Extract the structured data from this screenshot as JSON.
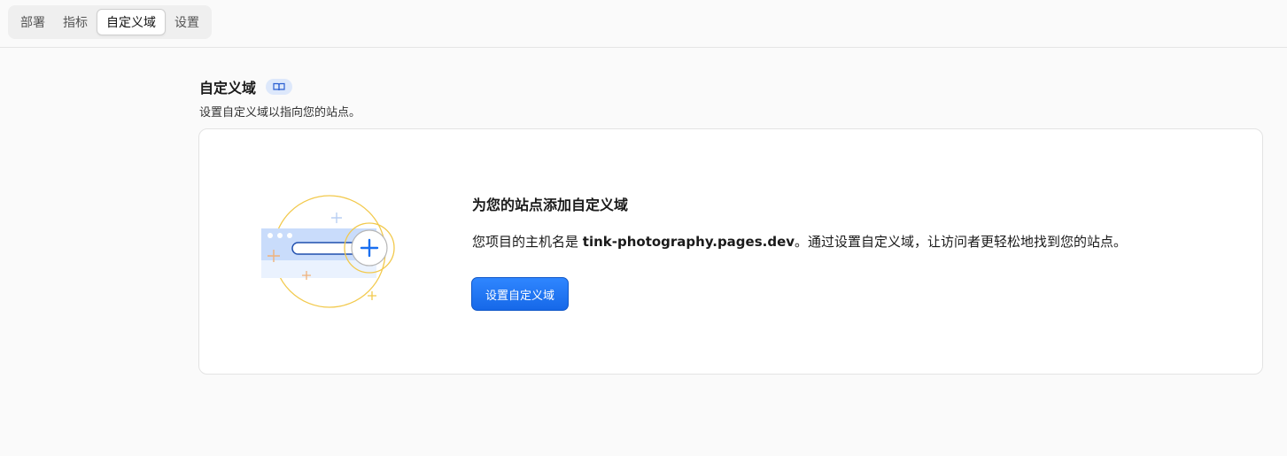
{
  "tabs": [
    {
      "label": "部署",
      "active": false
    },
    {
      "label": "指标",
      "active": false
    },
    {
      "label": "自定义域",
      "active": true
    },
    {
      "label": "设置",
      "active": false
    }
  ],
  "section": {
    "title": "自定义域",
    "doc_icon": "book-icon",
    "subtitle": "设置自定义域以指向您的站点。"
  },
  "card": {
    "title": "为您的站点添加自定义域",
    "desc_prefix": "您项目的主机名是 ",
    "hostname": "tink-photography.pages.dev",
    "desc_suffix": "。通过设置自定义域，让访问者更轻松地找到您的站点。",
    "button_label": "设置自定义域"
  },
  "colors": {
    "accent": "#1a6ff0",
    "illustration_ring": "#f2c94c",
    "illustration_browser": "#c9dcfb"
  }
}
